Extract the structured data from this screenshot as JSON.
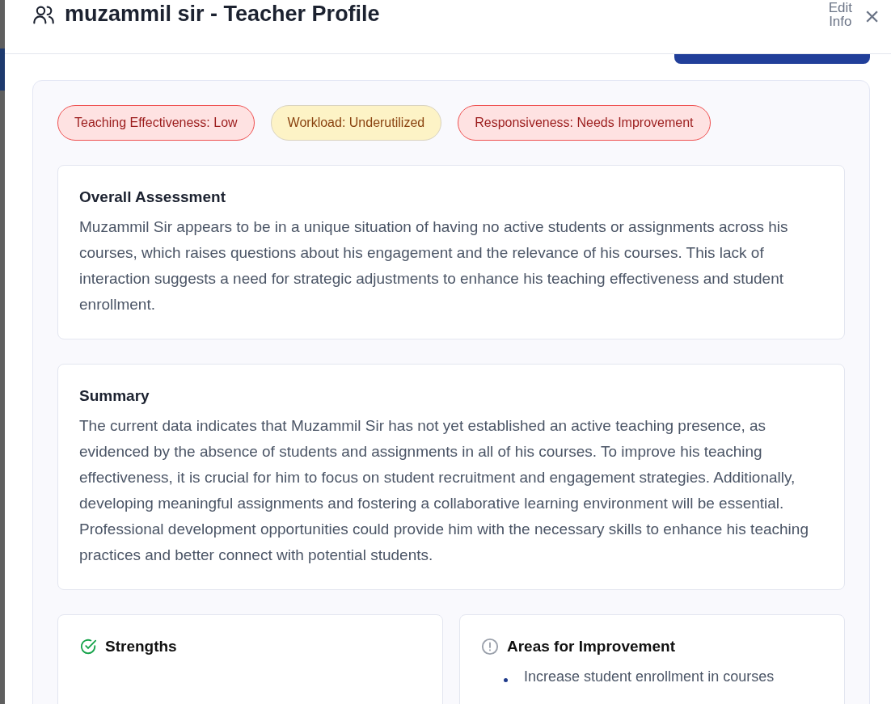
{
  "header": {
    "title": "muzammil sir - Teacher Profile",
    "edit_label": "Edit Info",
    "close": "×"
  },
  "badges": [
    {
      "label": "Teaching Effectiveness: Low",
      "kind": "danger"
    },
    {
      "label": "Workload: Underutilized",
      "kind": "warning"
    },
    {
      "label": "Responsiveness: Needs Improvement",
      "kind": "danger"
    }
  ],
  "sections": [
    {
      "title": "Overall Assessment",
      "text": "Muzammil Sir appears to be in a unique situation of having no active students or assignments across his courses, which raises questions about his engagement and the relevance of his courses. This lack of interaction suggests a need for strategic adjustments to enhance his teaching effectiveness and student enrollment."
    },
    {
      "title": "Summary",
      "text": "The current data indicates that Muzammil Sir has not yet established an active teaching presence, as evidenced by the absence of students and assignments in all of his courses. To improve his teaching effectiveness, it is crucial for him to focus on student recruitment and engagement strategies. Additionally, developing meaningful assignments and fostering a collaborative learning environment will be essential. Professional development opportunities could provide him with the necessary skills to enhance his teaching practices and better connect with potential students."
    }
  ],
  "columns": [
    {
      "title": "Strengths",
      "kind": "strengths"
    },
    {
      "title": "Areas for Improvement",
      "kind": "improvements",
      "items": [
        "Increase student enrollment in courses"
      ]
    }
  ]
}
